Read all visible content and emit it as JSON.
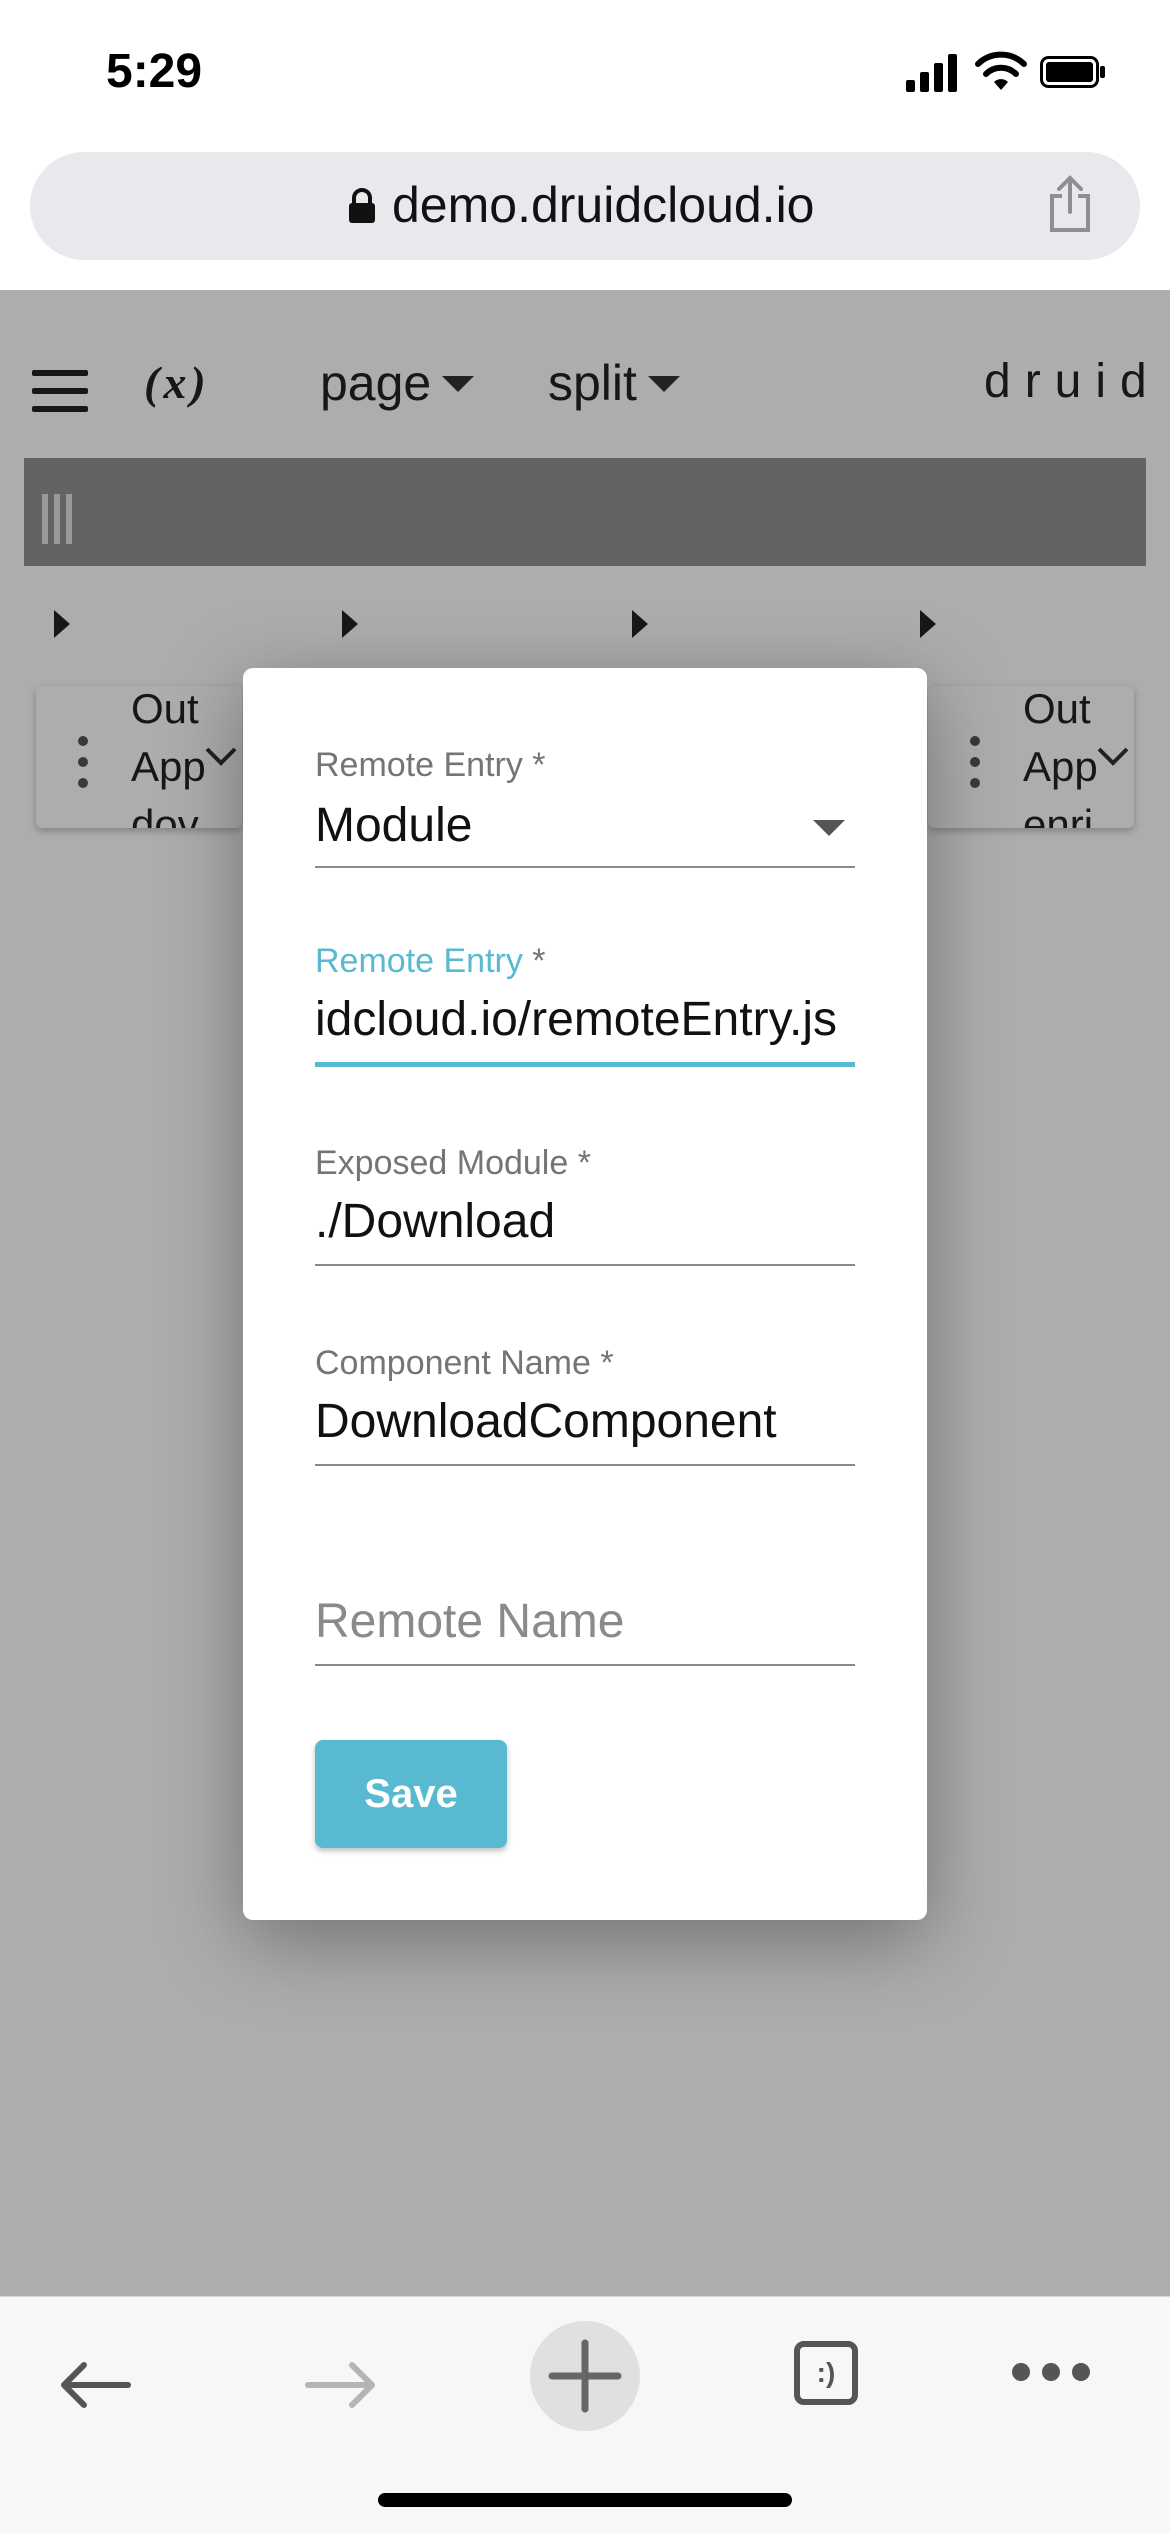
{
  "status_bar": {
    "time": "5:29"
  },
  "browser": {
    "url": "demo.druidcloud.io",
    "icons": [
      "lock-icon",
      "share-icon",
      "back-icon",
      "forward-icon",
      "new-tab-icon",
      "tabs-icon",
      "more-icon"
    ],
    "tabs_label": ":)"
  },
  "app": {
    "fx_label": "(x)",
    "menu": {
      "page": "page",
      "split": "split"
    },
    "brand": "druid",
    "cards": [
      {
        "lines": [
          "Out",
          "App",
          "dov"
        ]
      },
      {
        "lines": [
          "Out",
          "App",
          "enri"
        ]
      }
    ]
  },
  "dialog": {
    "remote_entry_type": {
      "label": "Remote Entry *",
      "value": "Module"
    },
    "remote_entry": {
      "label": "Remote Entry",
      "required_mark": " *",
      "value": "idcloud.io/remoteEntry.js"
    },
    "exposed_module": {
      "label": "Exposed Module *",
      "value": "./Download"
    },
    "component_name": {
      "label": "Component Name *",
      "value": "DownloadComponent"
    },
    "remote_name": {
      "placeholder": "Remote Name",
      "value": ""
    },
    "save_label": "Save"
  },
  "colors": {
    "accent": "#58b9d0",
    "overlay": "rgba(0,0,0,0.32)"
  }
}
